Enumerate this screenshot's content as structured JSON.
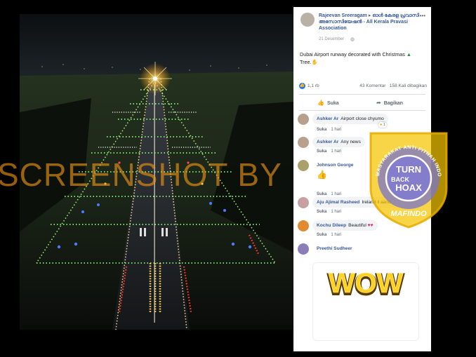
{
  "post": {
    "author": "Rajeevan Sreeragam",
    "group": "ഓൾ കേരള പ്രവാസി അസോസിയേഷൻ - All Kerala Pravasi Association",
    "more_label": "•••",
    "date": "21 Desember",
    "text": "Dubai Airport runway decorated with Christmas",
    "text2": "Tree.",
    "reactions_count": "1,1 rb",
    "comments_count": "43 Komentar",
    "shares_count": "158 Kali dibagikan",
    "like_label": "Suka",
    "share_label": "Bagikan"
  },
  "comments": [
    {
      "name": "Ashker Ar",
      "text": "Airport close chyumo",
      "like": "Suka",
      "time": "1 hari",
      "reaction_count": "1"
    },
    {
      "name": "Ashker Ar",
      "text": "Any news",
      "like": "Suka",
      "time": "1 hari"
    },
    {
      "name": "Johnson George",
      "text": "",
      "like": "Suka",
      "time": "1 hari"
    },
    {
      "name": "Aju Ajimal Rasheed",
      "text": "Ireland il aano",
      "like": "Suka",
      "time": "1 hari"
    },
    {
      "name": "Kochu Dileep",
      "text": "Beautiful",
      "like": "Suka",
      "time": "1 hari"
    },
    {
      "name": "Preethi Sudheer",
      "text": "",
      "sticker": "WOW"
    }
  ],
  "watermark": "SCREENSHOT BY",
  "logo": {
    "ring_text": "MASYARAKAT ANTI FITNAH INDONESIA",
    "bottom_text": "MAFINDO",
    "center_line1": "TURN",
    "center_line2": "BACK",
    "center_line3": "HOAX",
    "accent": "#f5c400",
    "ring_color": "#7d77c6"
  },
  "colors": {
    "link": "#385898",
    "like_blue": "#2078f4"
  }
}
